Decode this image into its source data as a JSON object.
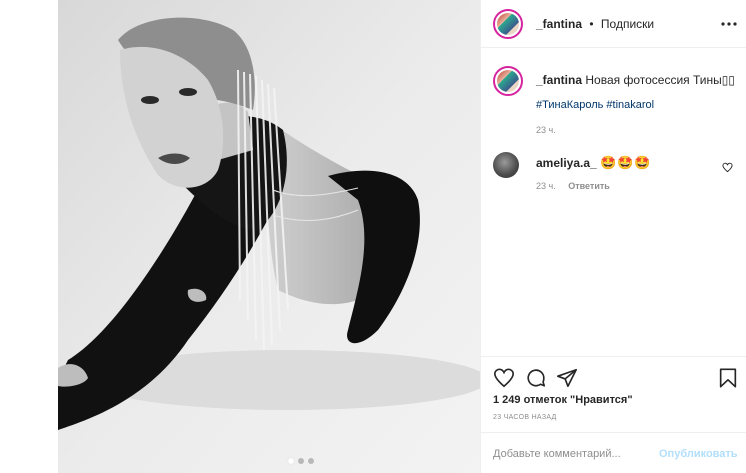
{
  "post": {
    "username": "_fantina",
    "follow_label": "Подписки",
    "bullet": "•",
    "caption_text": "Новая фотосессия Тины",
    "caption_emoji": "▯▯",
    "hashtags": "#ТинаКароль #tinakarol",
    "caption_time": "23 ч."
  },
  "comments": [
    {
      "username": "ameliya.a_",
      "emoji": "🤩🤩🤩",
      "time": "23 ч.",
      "reply_label": "Ответить"
    }
  ],
  "actions": {
    "likes_text": "1 249 отметок \"Нравится\"",
    "posted_time": "23 ЧАСОВ НАЗАД"
  },
  "add_comment": {
    "placeholder": "Добавьте комментарий...",
    "publish_label": "Опубликовать"
  },
  "carousel": {
    "total": 3,
    "active_index": 0
  },
  "icons": {
    "more": "more-horizontal-icon",
    "next": "chevron-right-icon",
    "like": "heart-outline-icon",
    "comment": "comment-bubble-icon",
    "share": "paper-plane-icon",
    "save": "bookmark-icon"
  },
  "colors": {
    "text": "#262626",
    "muted": "#8e8e8e",
    "hashtag": "#00376b",
    "publish_disabled": "#b2dffc",
    "story_ring": "#d6249f"
  }
}
